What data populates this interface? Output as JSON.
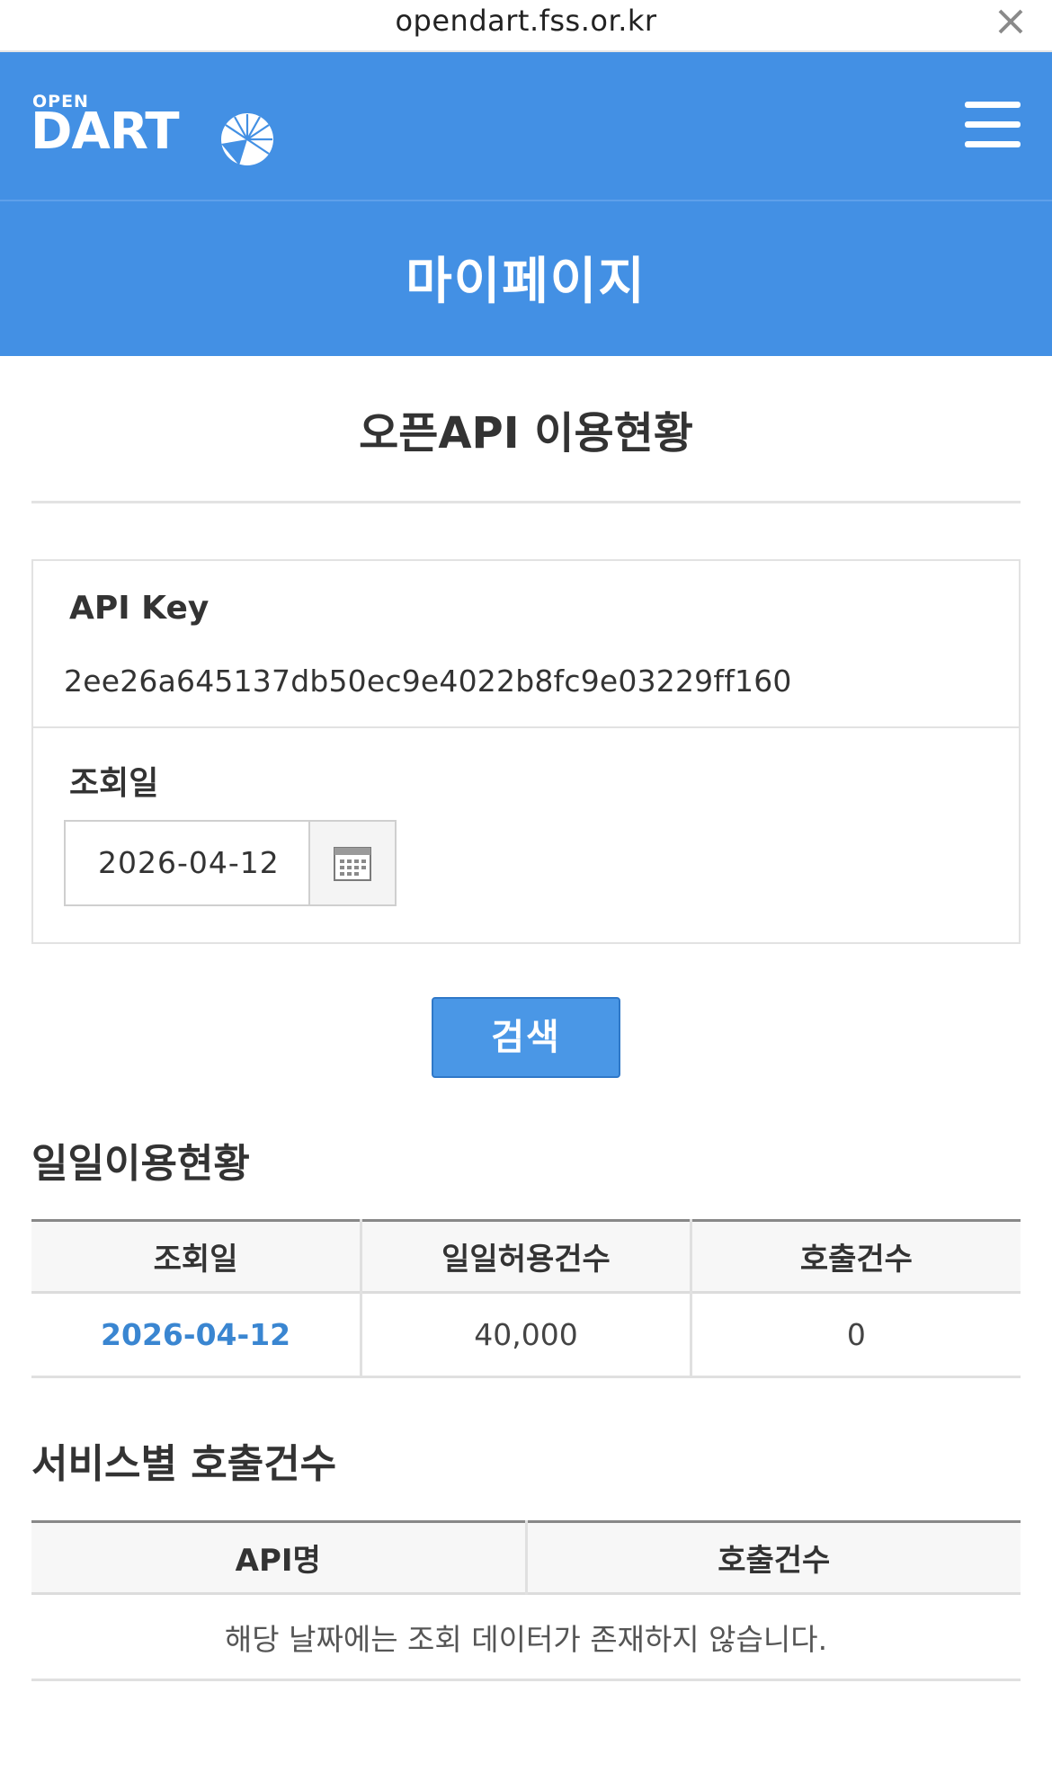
{
  "browser": {
    "url": "opendart.fss.or.kr"
  },
  "header": {
    "logo_top": "OPEN",
    "logo_main": "DART"
  },
  "page_title": "마이페이지",
  "section_title": "오픈API 이용현황",
  "form": {
    "api_key_label": "API Key",
    "api_key_value": "2ee26a645137db50ec9e4022b8fc9e03229ff160",
    "date_label": "조회일",
    "date_value": "2026-04-12"
  },
  "search_button": "검색",
  "daily": {
    "title": "일일이용현황",
    "headers": [
      "조회일",
      "일일허용건수",
      "호출건수"
    ],
    "rows": [
      [
        "2026-04-12",
        "40,000",
        "0"
      ]
    ]
  },
  "service": {
    "title": "서비스별 호출건수",
    "headers": [
      "API명",
      "호출건수"
    ],
    "empty_message": "해당 날짜에는 조회 데이터가 존재하지 않습니다."
  }
}
